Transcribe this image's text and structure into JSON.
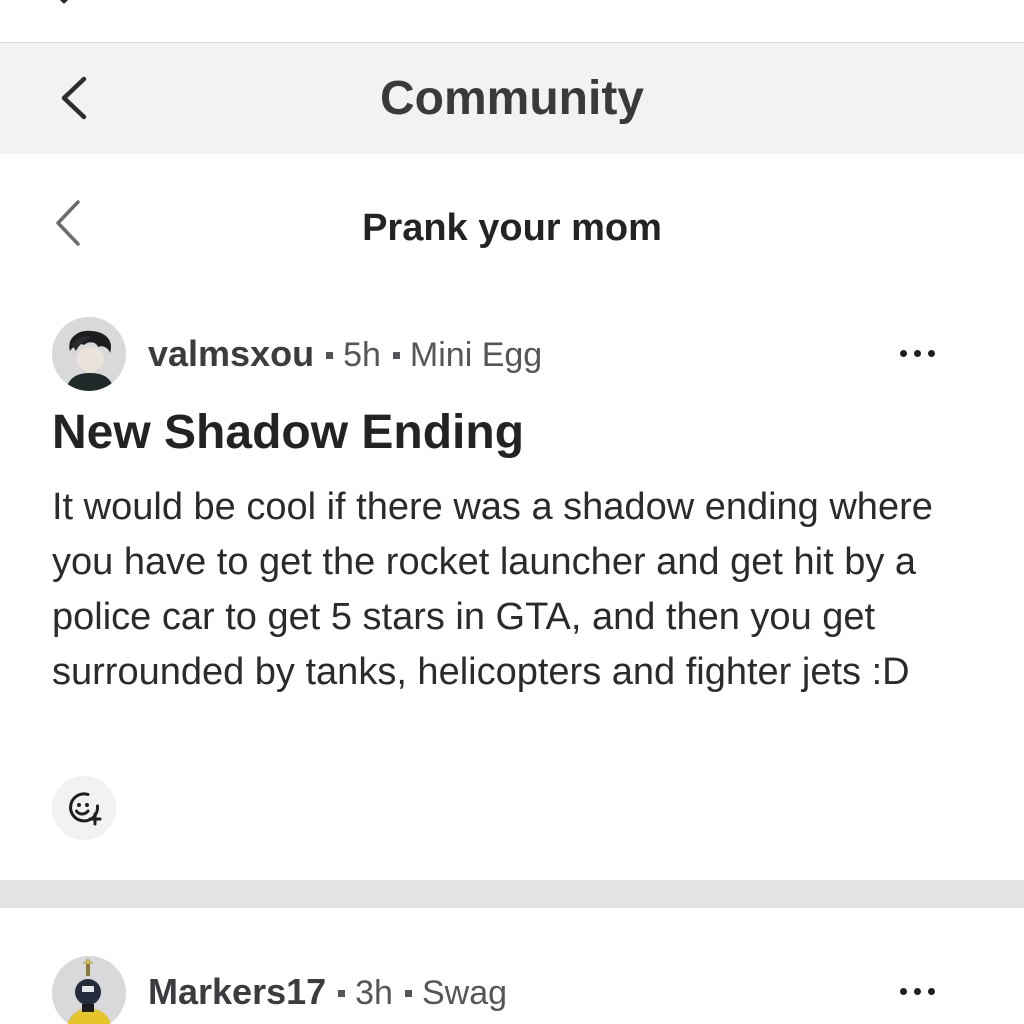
{
  "header": {
    "title": "Community"
  },
  "subheader": {
    "title": "Prank your mom"
  },
  "posts": [
    {
      "username": "valmsxou",
      "time": "5h",
      "category": "Mini Egg",
      "title": "New Shadow Ending",
      "body": "It would be cool if there was a shadow ending where you have to get the rocket launcher and get hit by a police car to get 5 stars in GTA, and then you get surrounded by tanks, helicopters and fighter jets :D"
    },
    {
      "username": "Markers17",
      "time": "3h",
      "category": "Swag"
    }
  ],
  "icons": {
    "back": "chevron-left-icon",
    "more": "more-horizontal-icon",
    "react": "add-reaction-icon"
  },
  "colors": {
    "header_bg": "#f1f2f3",
    "divider": "#e3e4e6",
    "text_primary": "#232326",
    "text_secondary": "#55565a"
  }
}
